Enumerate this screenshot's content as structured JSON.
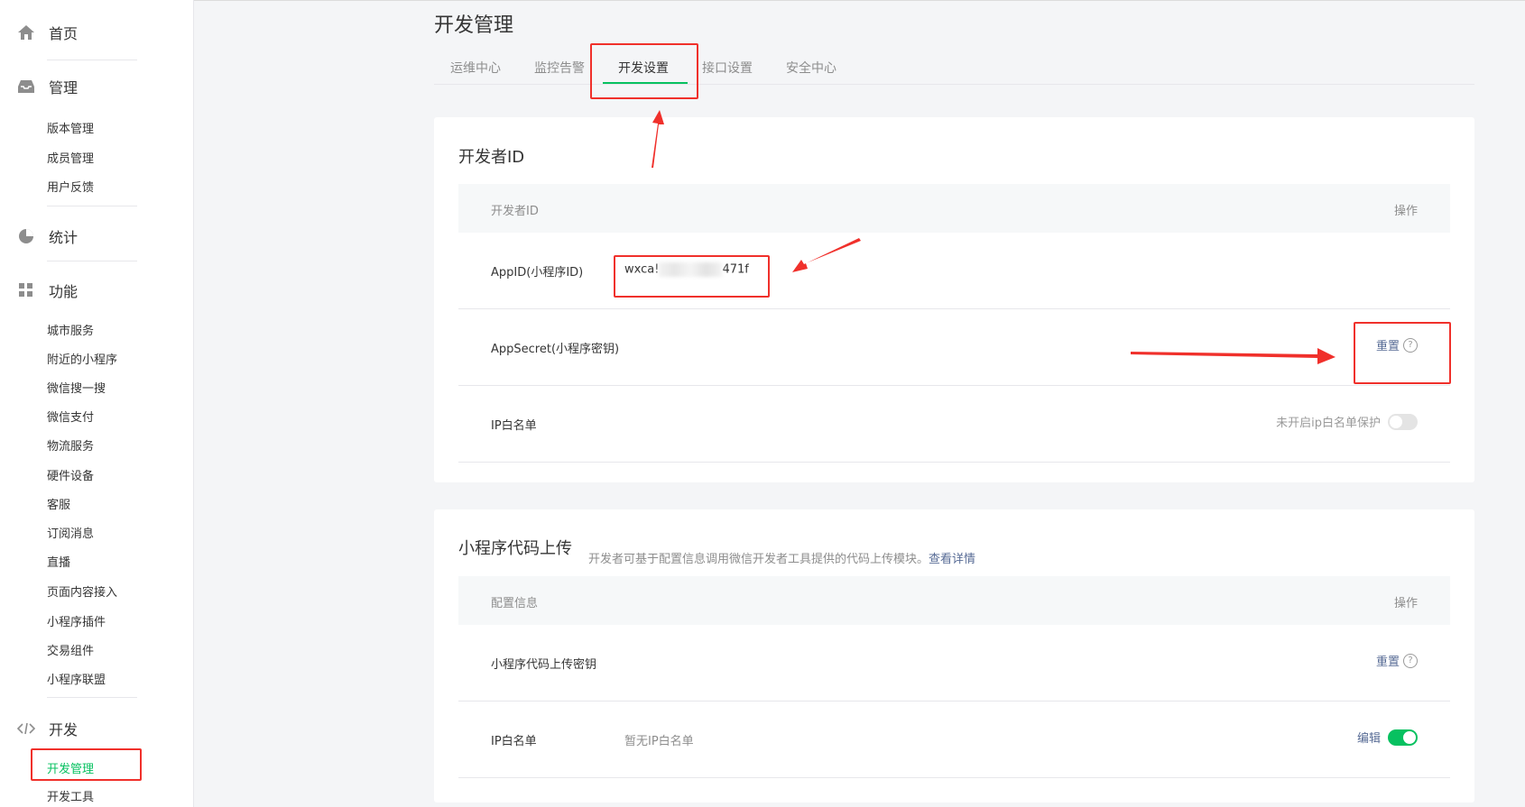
{
  "sidebar": {
    "home": "首页",
    "manage": "管理",
    "manage_items": [
      "版本管理",
      "成员管理",
      "用户反馈"
    ],
    "stats": "统计",
    "features": "功能",
    "feature_items": [
      "城市服务",
      "附近的小程序",
      "微信搜一搜",
      "微信支付",
      "物流服务",
      "硬件设备",
      "客服",
      "订阅消息",
      "直播",
      "页面内容接入",
      "小程序插件",
      "交易组件",
      "小程序联盟"
    ],
    "dev": "开发",
    "dev_items": [
      "开发管理",
      "开发工具"
    ]
  },
  "page": {
    "title": "开发管理",
    "tabs": [
      "运维中心",
      "监控告警",
      "开发设置",
      "接口设置",
      "安全中心"
    ]
  },
  "developer_id": {
    "title": "开发者ID",
    "header_left": "开发者ID",
    "header_right": "操作",
    "appid_label": "AppID(小程序ID)",
    "appid_prefix": "wxca!",
    "appid_suffix": "471f",
    "secret_label": "AppSecret(小程序密钥)",
    "secret_action": "重置",
    "ip_label": "IP白名单",
    "ip_status": "未开启ip白名单保护"
  },
  "code_upload": {
    "title": "小程序代码上传",
    "desc": "开发者可基于配置信息调用微信开发者工具提供的代码上传模块。",
    "desc_link": "查看详情",
    "header_left": "配置信息",
    "header_right": "操作",
    "key_label": "小程序代码上传密钥",
    "key_action": "重置",
    "ip_label": "IP白名单",
    "ip_value": "暂无IP白名单",
    "ip_action": "编辑"
  },
  "colors": {
    "accent": "#07c160",
    "link": "#576b95",
    "annotation": "#f0302b"
  }
}
